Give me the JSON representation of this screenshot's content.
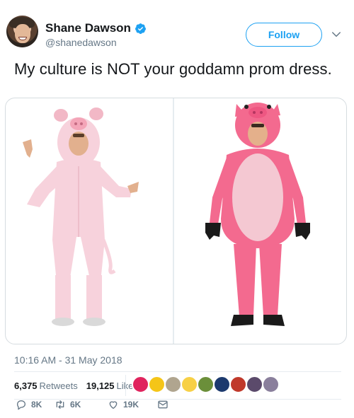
{
  "author": {
    "name": "Shane Dawson",
    "handle": "@shanedawson",
    "verified_icon": "verified-badge-icon",
    "avatar_icon": "avatar"
  },
  "header": {
    "follow_label": "Follow",
    "menu_icon": "chevron-down-icon"
  },
  "tweet": {
    "text": "My culture is NOT your goddamn prom dress.",
    "timestamp": "10:16 AM - 31 May 2018"
  },
  "media": {
    "images": [
      {
        "subject": "light pink pig onesie costume"
      },
      {
        "subject": "hot pink pig costume with black gloves"
      }
    ]
  },
  "stats": {
    "retweets_count": "6,375",
    "retweets_label": "Retweets",
    "likes_count": "19,125",
    "likes_label": "Likes"
  },
  "likers": [
    {
      "color": "#e0245e"
    },
    {
      "color": "#f5c518"
    },
    {
      "color": "#b0a58f"
    },
    {
      "color": "#f7d046"
    },
    {
      "color": "#6b8f3a"
    },
    {
      "color": "#1c3a6e"
    },
    {
      "color": "#c0392b"
    },
    {
      "color": "#5b4a6b"
    },
    {
      "color": "#8a7f9c"
    }
  ],
  "actions": {
    "reply_count": "8K",
    "retweet_count": "6K",
    "like_count": "19K"
  },
  "colors": {
    "accent": "#1da1f2",
    "muted": "#657786",
    "text": "#14171a"
  }
}
